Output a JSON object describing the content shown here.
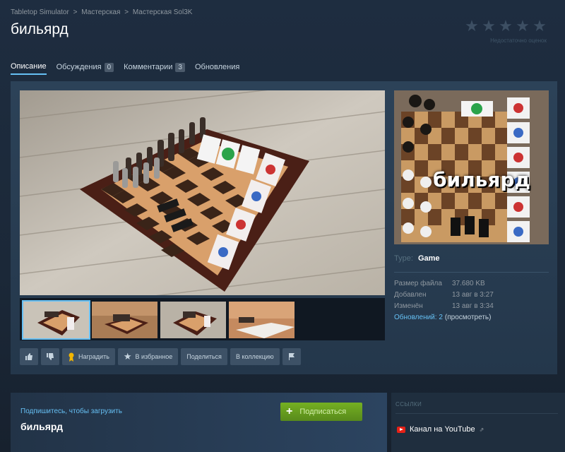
{
  "breadcrumb": {
    "items": [
      "Tabletop Simulator",
      "Мастерская",
      "Мастерская Sol3K"
    ],
    "separator": ">"
  },
  "title": "бильярд",
  "rating": {
    "stars": 5,
    "filled": 0,
    "text": "Недостаточно оценок"
  },
  "tabs": [
    {
      "label": "Описание",
      "active": true
    },
    {
      "label": "Обсуждения",
      "count": "0"
    },
    {
      "label": "Комментарии",
      "count": "3"
    },
    {
      "label": "Обновления"
    }
  ],
  "side_image_caption": "бильярд",
  "details": {
    "type_label": "Type:",
    "type_value": "Game",
    "rows": [
      {
        "key": "Размер файла",
        "value": "37.680 KB"
      },
      {
        "key": "Добавлен",
        "value": "13 авг в 3:27"
      },
      {
        "key": "Изменён",
        "value": "13 авг в 3:34"
      }
    ],
    "updates_link": "Обновлений: 2",
    "updates_view": "(просмотреть)"
  },
  "actions": {
    "thumbs_up_icon": "thumbs-up-icon",
    "thumbs_down_icon": "thumbs-down-icon",
    "award_label": "Наградить",
    "favorite_label": "В избранное",
    "share_label": "Поделиться",
    "collection_label": "В коллекцию",
    "report_icon": "flag-icon"
  },
  "subscribe": {
    "hint": "Подпишитесь, чтобы загрузить",
    "title": "бильярд",
    "button_label": "Подписаться"
  },
  "links": {
    "title": "ССЫЛКИ",
    "youtube_label": "Канал на YouTube"
  },
  "colors": {
    "accent": "#66c0f4",
    "subscribe_green": "#75b022",
    "background": "#1b2838"
  }
}
